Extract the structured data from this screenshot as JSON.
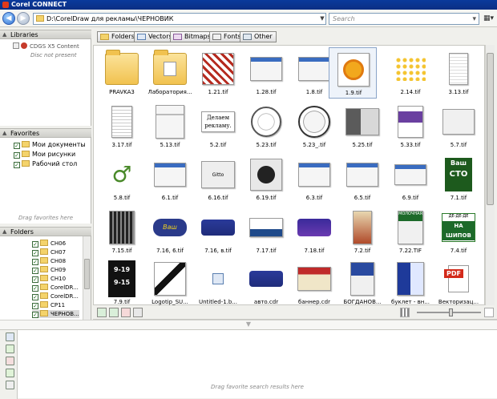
{
  "window": {
    "title": "Corel CONNECT"
  },
  "address": {
    "path": "D:\\CorelDraw для рекламы\\ЧЕРНОВИК",
    "search_placeholder": "Search"
  },
  "libraries": {
    "header": "Libraries",
    "item": "CDGS X5 Content",
    "item_note": "Disc not present"
  },
  "favorites": {
    "header": "Favorites",
    "items": [
      "Мои документы",
      "Мои рисунки",
      "Рабочий стол"
    ],
    "hint": "Drag favorites here"
  },
  "folders": {
    "header": "Folders",
    "items": [
      "CH06",
      "CH07",
      "CH08",
      "CH09",
      "CH10",
      "CorelDR...",
      "CorelDR...",
      "CP11",
      "ЧЕРНОВ..."
    ],
    "selected_index": 8
  },
  "filters": {
    "folders": "Folders",
    "vectors": "Vectors",
    "bitmaps": "Bitmaps",
    "fonts": "Fonts",
    "other": "Other"
  },
  "files": [
    "PRAVKA3",
    "Лаборатория...",
    "1.21.tif",
    "1.28.tif",
    "1.8.tif",
    "1.9.tif",
    "2.14.tif",
    "3.13.tif",
    "3.17.tif",
    "5.13.tif",
    "5.2.tif",
    "5.23.tif",
    "5.23_.tif",
    "5.25.tif",
    "5.33.tif",
    "5.7.tif",
    "5.8.tif",
    "6.1.tif",
    "6.16.tif",
    "6.19.tif",
    "6.3.tif",
    "6.5.tif",
    "6.9.tif",
    "7.1.tif",
    "7.15.tif",
    "7.16, 6.tif",
    "7.16, в.tif",
    "7.17.tif",
    "7.18.tif",
    "7.2.tif",
    "7.22.TIF",
    "7.4.tif",
    "7.9.tif",
    "Logotip_SU...",
    "Untitled-1.b...",
    "авто.cdr",
    "баннер.cdr",
    "БОГДАНОВ...",
    "буклет - вн...",
    "Векторизац..."
  ],
  "thumb_text": {
    "t52": "Делаем рекламу.",
    "t616": "Gitto",
    "t71a": "Ваш",
    "t71b": "СТО",
    "t722": "МОЛОЧНАЯ",
    "t74a": "ДЕ-ДЕ-ДЕ",
    "t74b": "НА ШИПОВ",
    "t79a": "9-19",
    "t79b": "9-15",
    "pdf": "PDF"
  },
  "tray": {
    "hint": "Drag favorite search results here"
  }
}
